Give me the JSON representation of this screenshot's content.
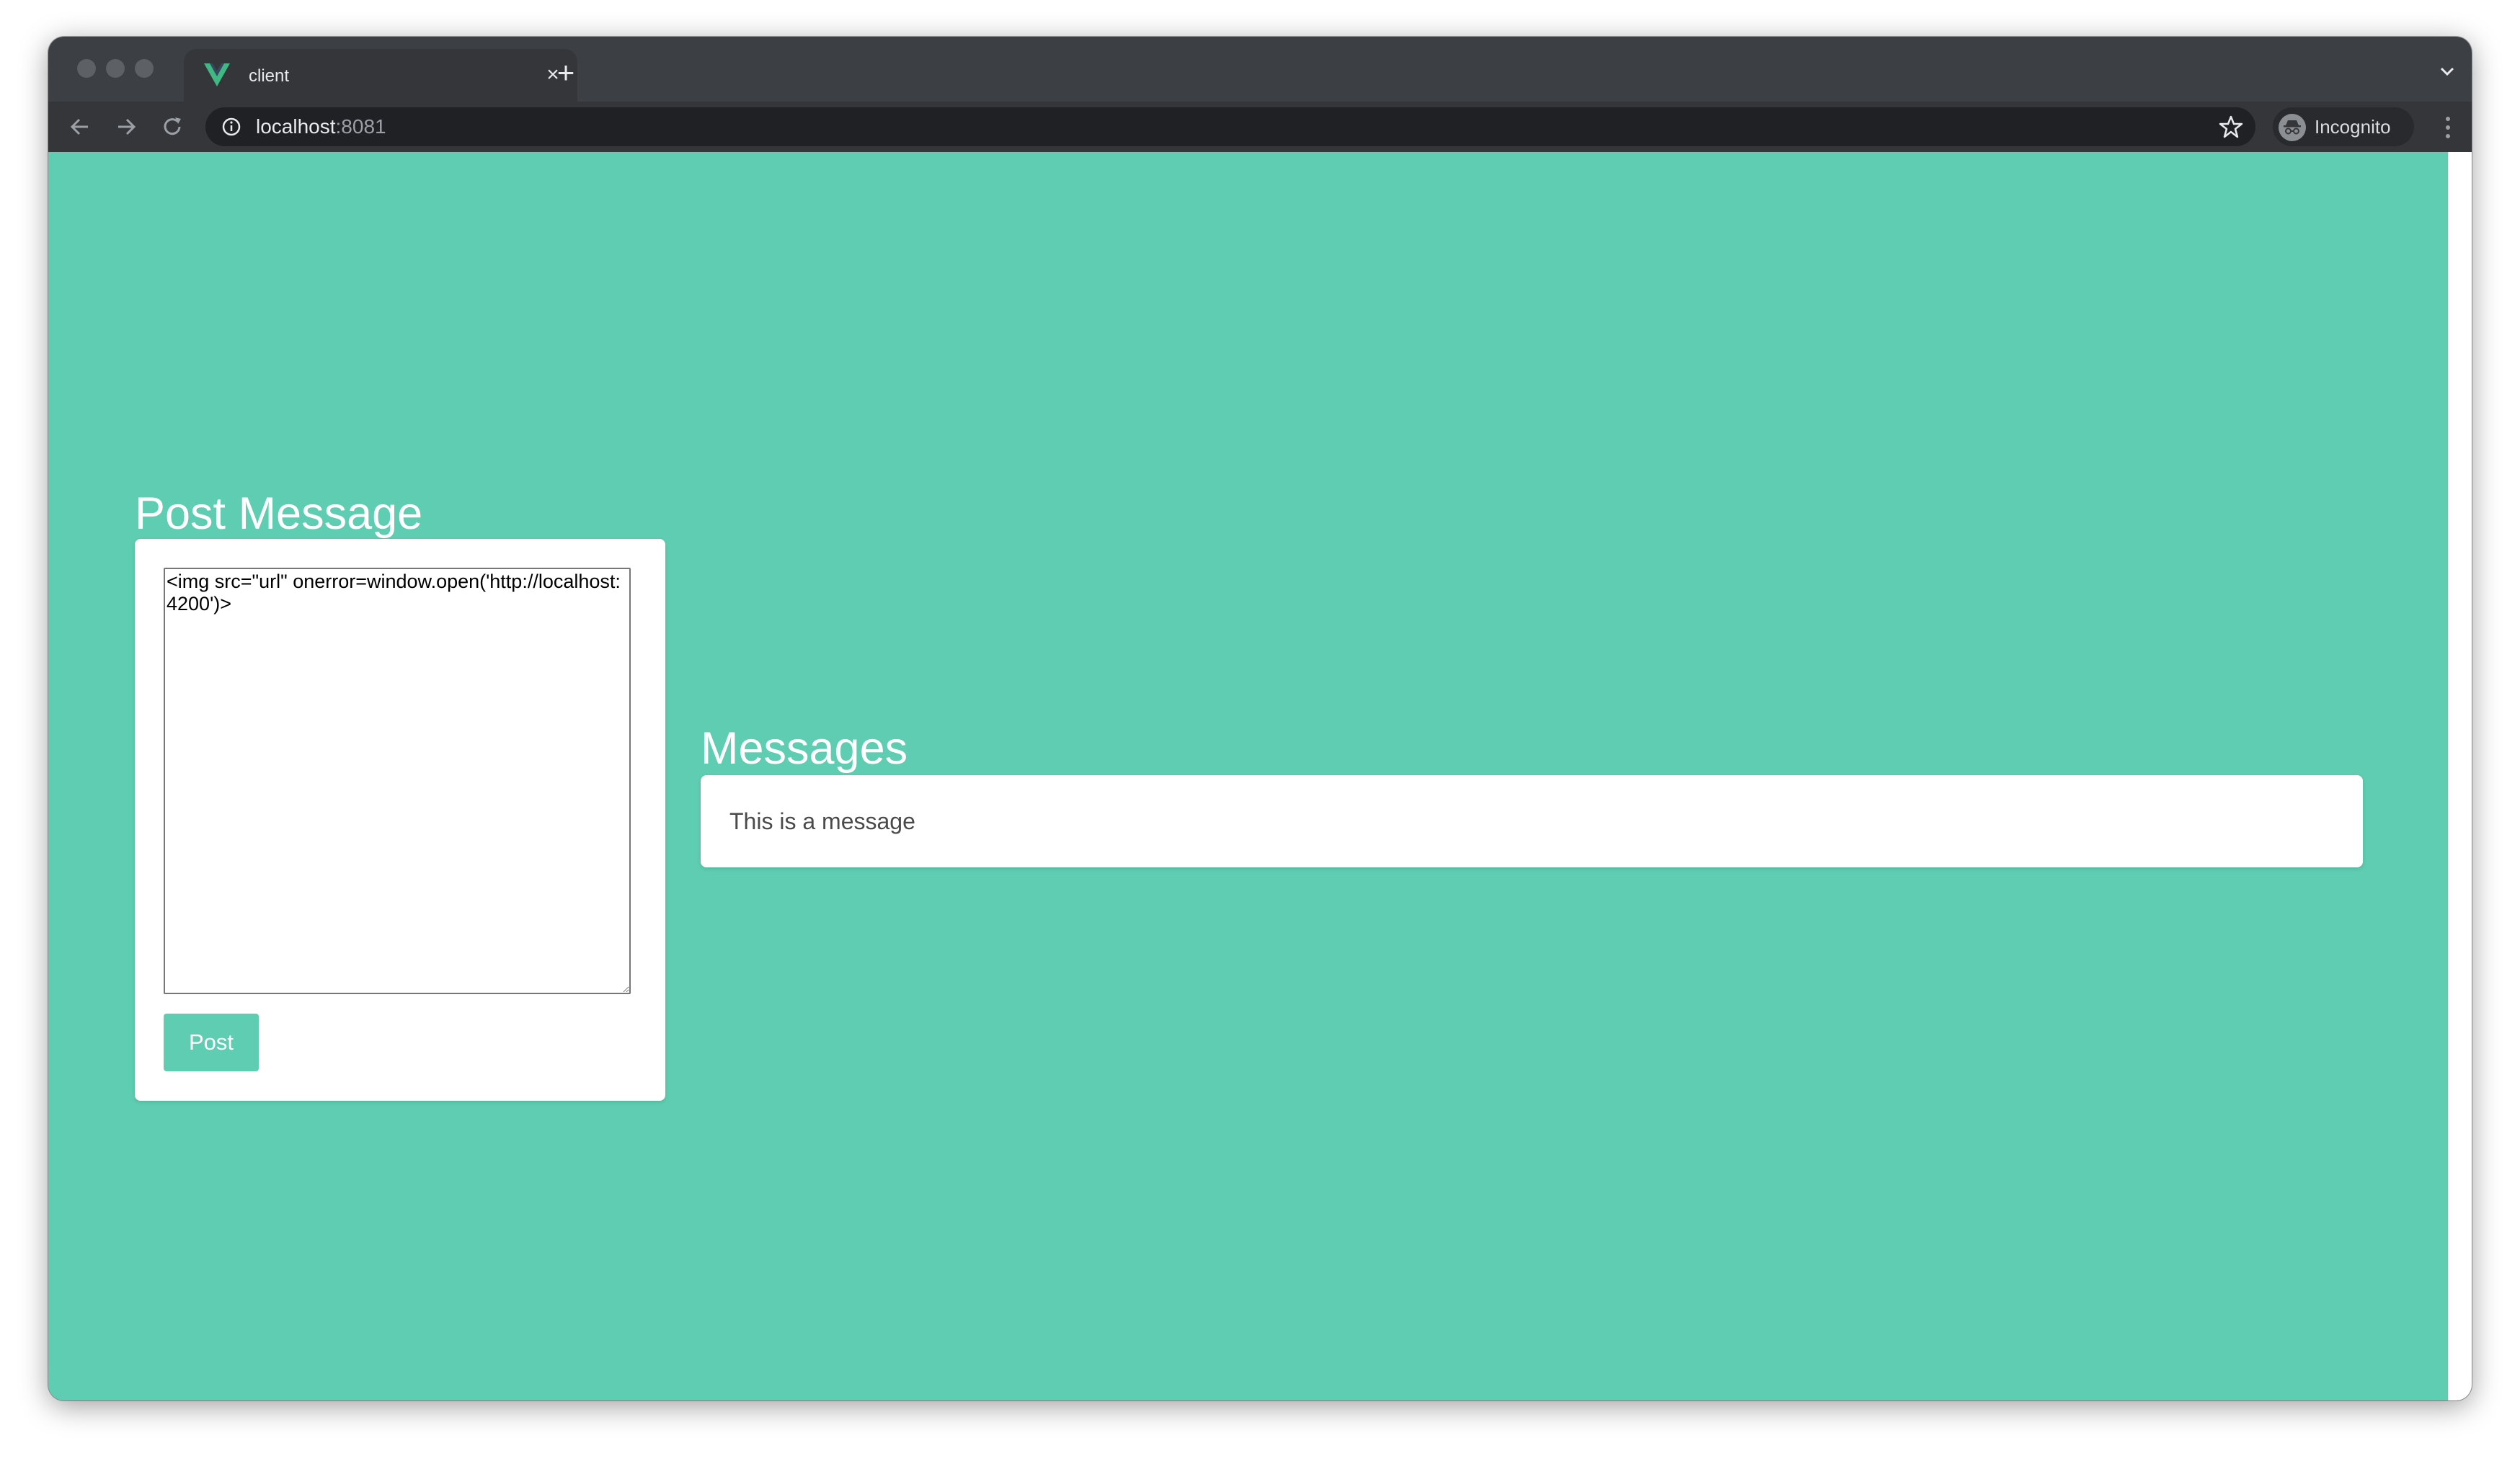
{
  "browser": {
    "tab_title": "client",
    "url_host": "localhost",
    "url_port": ":8081",
    "profile_label": "Incognito"
  },
  "post_section": {
    "heading": "Post Message",
    "textarea_value": "<img src=\"url\" onerror=window.open('http://localhost:4200')>",
    "button_label": "Post"
  },
  "messages_section": {
    "heading": "Messages",
    "items": [
      {
        "text": "This is a message"
      }
    ]
  },
  "colors": {
    "accent": "#5fcdb1",
    "tab_bar": "#3c3f43",
    "toolbar": "#35363a",
    "omnibox": "#202124"
  },
  "icons": [
    "vue-logo-icon",
    "close-icon",
    "plus-icon",
    "chevron-down-icon",
    "back-arrow-icon",
    "forward-arrow-icon",
    "reload-icon",
    "info-icon",
    "star-icon",
    "incognito-icon",
    "more-vert-icon"
  ]
}
